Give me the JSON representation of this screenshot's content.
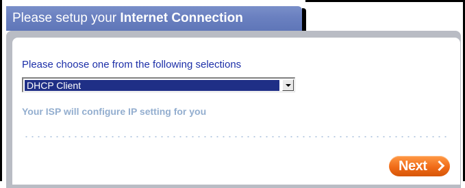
{
  "header": {
    "title_prefix": "Please setup your ",
    "title_bold": "Internet Connection",
    "tab_color": "#6a80c0"
  },
  "form": {
    "prompt": "Please choose one from the following selections",
    "connection_type": {
      "selected": "DHCP Client"
    },
    "info_text": "Your ISP will configure IP setting for you",
    "info_color": "#93aecf"
  },
  "actions": {
    "next_label": "Next",
    "next_icon": "chevron-right-icon",
    "next_color": "#f06b18"
  }
}
